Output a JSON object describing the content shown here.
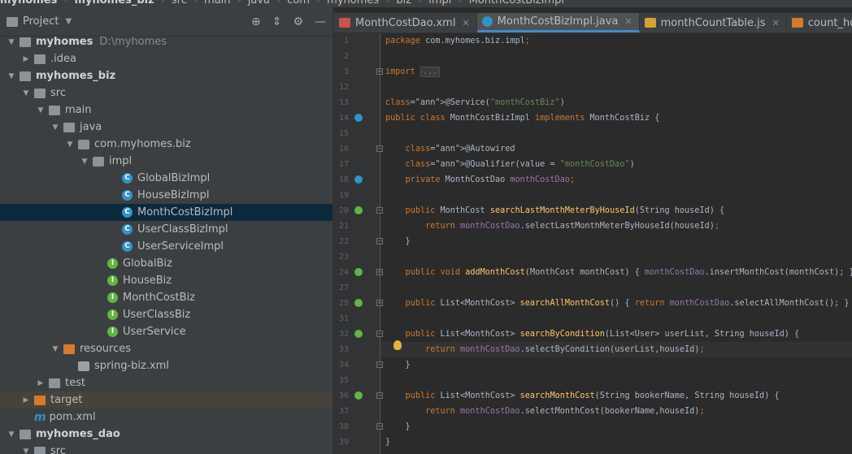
{
  "breadcrumb": [
    "myhomes",
    "myhomes_biz",
    "src",
    "main",
    "java",
    "com",
    "myhomes",
    "biz",
    "impl",
    "MonthCostBizImpl"
  ],
  "project_panel": {
    "title": "Project",
    "tree": [
      {
        "label": "myhomes",
        "path": "D:\\myhomes",
        "icon": "module-folder-icon",
        "expanded": true
      },
      {
        "label": ".idea",
        "icon": "folder-icon",
        "expanded": false
      },
      {
        "label": "myhomes_biz",
        "icon": "module-folder-icon",
        "expanded": true
      },
      {
        "label": "src",
        "icon": "folder-icon",
        "expanded": true
      },
      {
        "label": "main",
        "icon": "folder-icon",
        "expanded": true
      },
      {
        "label": "java",
        "icon": "source-folder-icon",
        "expanded": true
      },
      {
        "label": "com.myhomes.biz",
        "icon": "package-icon",
        "expanded": true
      },
      {
        "label": "impl",
        "icon": "package-icon",
        "expanded": true
      },
      {
        "label": "GlobalBizImpl",
        "icon": "class-icon"
      },
      {
        "label": "HouseBizImpl",
        "icon": "class-icon"
      },
      {
        "label": "MonthCostBizImpl",
        "icon": "class-icon",
        "selected": true
      },
      {
        "label": "UserClassBizImpl",
        "icon": "class-icon"
      },
      {
        "label": "UserServiceImpl",
        "icon": "class-icon"
      },
      {
        "label": "GlobalBiz",
        "icon": "interface-icon"
      },
      {
        "label": "HouseBiz",
        "icon": "interface-icon"
      },
      {
        "label": "MonthCostBiz",
        "icon": "interface-icon"
      },
      {
        "label": "UserClassBiz",
        "icon": "interface-icon"
      },
      {
        "label": "UserService",
        "icon": "interface-icon"
      },
      {
        "label": "resources",
        "icon": "resources-folder-icon",
        "expanded": true
      },
      {
        "label": "spring-biz.xml",
        "icon": "xml-file-icon"
      },
      {
        "label": "test",
        "icon": "folder-icon",
        "expanded": false
      },
      {
        "label": "target",
        "icon": "excluded-folder-icon",
        "expanded": false
      },
      {
        "label": "pom.xml",
        "icon": "maven-file-icon"
      },
      {
        "label": "myhomes_dao",
        "icon": "module-folder-icon",
        "expanded": true
      },
      {
        "label": "src",
        "icon": "folder-icon",
        "expanded": true
      }
    ]
  },
  "tabs": [
    {
      "label": "MonthCostDao.xml",
      "icon": "xml-file-icon"
    },
    {
      "label": "MonthCostBizImpl.java",
      "icon": "java-class-icon",
      "active": true
    },
    {
      "label": "monthCountTable.js",
      "icon": "js-file-icon"
    },
    {
      "label": "count_house_table",
      "icon": "jsp-file-icon"
    }
  ],
  "editor": {
    "lines": [
      {
        "n": "1",
        "t": "package com.myhomes.biz.impl;"
      },
      {
        "n": "2",
        "t": ""
      },
      {
        "n": "3",
        "t": "import ..."
      },
      {
        "n": "12",
        "t": ""
      },
      {
        "n": "13",
        "t": "@Service(\"monthCostBiz\")"
      },
      {
        "n": "14",
        "t": "public class MonthCostBizImpl implements MonthCostBiz {"
      },
      {
        "n": "15",
        "t": ""
      },
      {
        "n": "16",
        "t": "    @Autowired"
      },
      {
        "n": "17",
        "t": "    @Qualifier(value = \"monthCostDao\")"
      },
      {
        "n": "18",
        "t": "    private MonthCostDao monthCostDao;"
      },
      {
        "n": "19",
        "t": ""
      },
      {
        "n": "20",
        "t": "    public MonthCost searchLastMonthMeterByHouseId(String houseId) {"
      },
      {
        "n": "21",
        "t": "        return monthCostDao.selectLastMonthMeterByHouseId(houseId);"
      },
      {
        "n": "22",
        "t": "    }"
      },
      {
        "n": "23",
        "t": ""
      },
      {
        "n": "24",
        "t": "    public void addMonthCost(MonthCost monthCost) { monthCostDao.insertMonthCost(monthCost); }"
      },
      {
        "n": "27",
        "t": ""
      },
      {
        "n": "28",
        "t": "    public List<MonthCost> searchAllMonthCost() { return monthCostDao.selectAllMonthCost(); }"
      },
      {
        "n": "31",
        "t": ""
      },
      {
        "n": "32",
        "t": "    public List<MonthCost> searchByCondition(List<User> userList, String houseId) {"
      },
      {
        "n": "33",
        "t": "        return monthCostDao.selectByCondition(userList,houseId);"
      },
      {
        "n": "34",
        "t": "    }"
      },
      {
        "n": "35",
        "t": ""
      },
      {
        "n": "36",
        "t": "    public List<MonthCost> searchMonthCost(String bookerName, String houseId) {"
      },
      {
        "n": "37",
        "t": "        return monthCostDao.selectMonthCost(bookerName,houseId);"
      },
      {
        "n": "38",
        "t": "    }"
      },
      {
        "n": "39",
        "t": "}"
      }
    ]
  }
}
